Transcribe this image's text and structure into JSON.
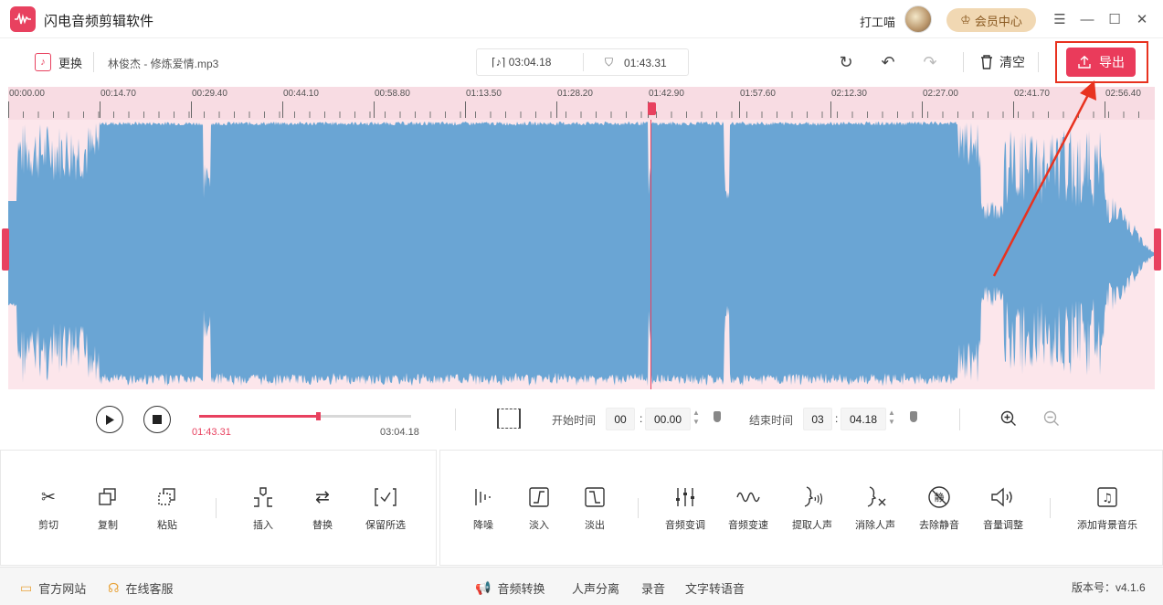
{
  "window": {
    "app_title": "闪电音频剪辑软件",
    "user_name": "打工喵",
    "vip_label": "会员中心",
    "controls": {
      "menu": "☰",
      "minimize": "—",
      "maximize": "☐",
      "close": "✕"
    }
  },
  "toolbar": {
    "change_label": "更换",
    "file_name": "林俊杰 - 修炼爱情.mp3",
    "total_time": "03:04.18",
    "current_time": "01:43.31",
    "clear_label": "清空",
    "export_label": "导出"
  },
  "ruler": {
    "ticks": [
      "00:00.00",
      "00:14.70",
      "00:29.40",
      "00:44.10",
      "00:58.80",
      "01:13.50",
      "01:28.20",
      "01:42.90",
      "01:57.60",
      "02:12.30",
      "02:27.00",
      "02:41.70",
      "02:56.40"
    ]
  },
  "transport": {
    "elapsed": "01:43.31",
    "total": "03:04.18",
    "progress": 0.56,
    "start_label": "开始时间",
    "start_min": "00",
    "start_sec": "00.00",
    "end_label": "结束时间",
    "end_min": "03",
    "end_sec": "04.18",
    "colon": ":"
  },
  "tools_left": [
    {
      "label": "剪切",
      "icon": "scissors-icon"
    },
    {
      "label": "复制",
      "icon": "copy-icon"
    },
    {
      "label": "粘贴",
      "icon": "paste-icon"
    },
    {
      "label": "插入",
      "icon": "insert-icon"
    },
    {
      "label": "替换",
      "icon": "replace-icon"
    },
    {
      "label": "保留所选",
      "icon": "keep-selection-icon"
    }
  ],
  "tools_right": [
    {
      "label": "降噪",
      "icon": "denoise-icon"
    },
    {
      "label": "淡入",
      "icon": "fade-in-icon"
    },
    {
      "label": "淡出",
      "icon": "fade-out-icon"
    },
    {
      "label": "音频变调",
      "icon": "pitch-icon"
    },
    {
      "label": "音频变速",
      "icon": "speed-icon"
    },
    {
      "label": "提取人声",
      "icon": "extract-voice-icon"
    },
    {
      "label": "消除人声",
      "icon": "remove-voice-icon"
    },
    {
      "label": "去除静音",
      "icon": "remove-silence-icon"
    },
    {
      "label": "音量调整",
      "icon": "volume-icon"
    },
    {
      "label": "添加背景音乐",
      "icon": "bg-music-icon"
    }
  ],
  "footer": {
    "website": "官方网站",
    "support": "在线客服",
    "convert": "音频转换",
    "separate": "人声分离",
    "record": "录音",
    "tts": "文字转语音",
    "version": "版本号：v4.1.6"
  },
  "colors": {
    "accent": "#e8415f",
    "waveform": "#6aa5d4",
    "wave_bg": "#fce6eb",
    "annotation": "#e8321f"
  }
}
